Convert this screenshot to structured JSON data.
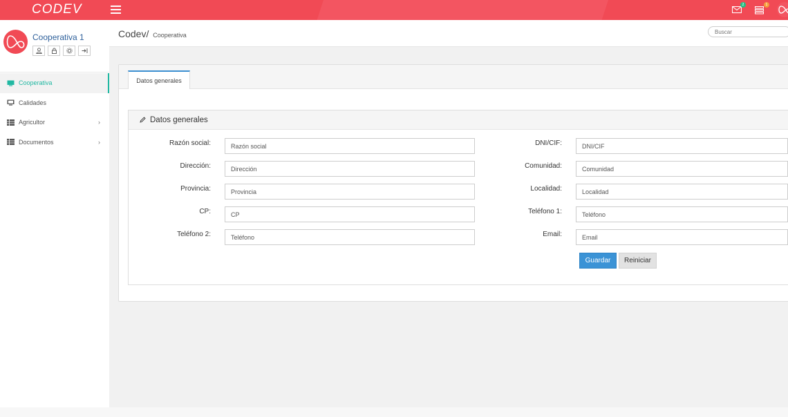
{
  "brand": {
    "name": "CODEV"
  },
  "topbar": {
    "icons": [
      {
        "name": "mail-icon",
        "badge": "2"
      },
      {
        "name": "tasks-icon",
        "badge": "1"
      }
    ]
  },
  "profile": {
    "username": "Cooperativa 1",
    "actions": [
      "user-icon",
      "lock-icon",
      "gear-icon",
      "logout-icon"
    ]
  },
  "sidebar": {
    "items": [
      {
        "label": "Cooperativa",
        "icon": "monitor-icon",
        "active": true
      },
      {
        "label": "Calidades",
        "icon": "monitor-icon"
      },
      {
        "label": "Agricultor",
        "icon": "table-icon",
        "has_children": true
      },
      {
        "label": "Documentos",
        "icon": "table-icon",
        "has_children": true
      }
    ]
  },
  "header": {
    "breadcrumb_root": "Codev/",
    "breadcrumb_current": "Cooperativa",
    "search_placeholder": "Buscar"
  },
  "tabs": [
    {
      "label": "Datos generales"
    }
  ],
  "panel": {
    "title": "Datos generales"
  },
  "form": {
    "left": [
      {
        "label": "Razón social:",
        "placeholder": "Razón social"
      },
      {
        "label": "Dirección:",
        "placeholder": "Dirección"
      },
      {
        "label": "Provincia:",
        "placeholder": "Provincia"
      },
      {
        "label": "CP:",
        "placeholder": "CP"
      },
      {
        "label": "Teléfono 2:",
        "placeholder": "Teléfono"
      }
    ],
    "right": [
      {
        "label": "DNI/CIF:",
        "placeholder": "DNI/CIF"
      },
      {
        "label": "Comunidad:",
        "placeholder": "Comunidad"
      },
      {
        "label": "Localidad:",
        "placeholder": "Localidad"
      },
      {
        "label": "Teléfono 1:",
        "placeholder": "Teléfono"
      },
      {
        "label": "Email:",
        "placeholder": "Email"
      }
    ],
    "save_label": "Guardar",
    "reset_label": "Reiniciar"
  },
  "colors": {
    "topbar": "#f14a55",
    "accent_teal": "#20b8a2",
    "primary_button": "#3b93d6"
  }
}
